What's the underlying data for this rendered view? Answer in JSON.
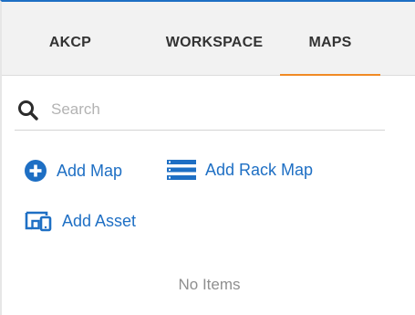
{
  "tabs": [
    {
      "label": "AKCP",
      "active": false
    },
    {
      "label": "WORKSPACE",
      "active": false
    },
    {
      "label": "MAPS",
      "active": true
    }
  ],
  "search": {
    "placeholder": "Search",
    "value": ""
  },
  "actions": {
    "add_map": {
      "label": "Add Map",
      "icon": "plus-circle-icon"
    },
    "add_rack_map": {
      "label": "Add Rack Map",
      "icon": "rack-icon"
    },
    "add_asset": {
      "label": "Add Asset",
      "icon": "asset-devices-icon"
    }
  },
  "empty_state": {
    "text": "No Items"
  },
  "colors": {
    "accent": "#1e6fc4",
    "active_tab_underline": "#f08a24",
    "tab_bar_bg": "#f2f2f2",
    "muted_text": "#8f8f8f"
  }
}
